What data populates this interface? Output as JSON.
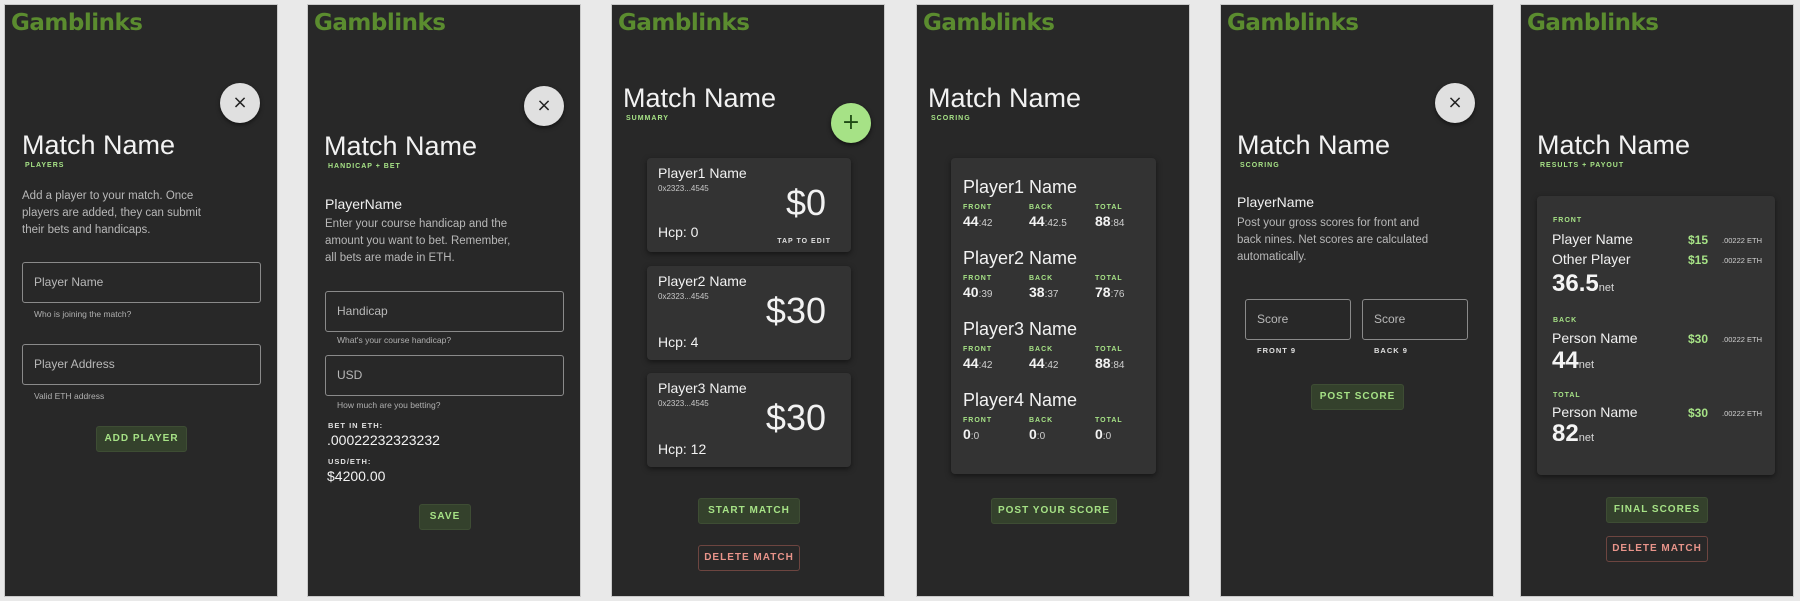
{
  "brand": "Gamblinks",
  "screens": {
    "players": {
      "title": "Match Name",
      "subtitle": "PLAYERS",
      "close": "×",
      "intro": "Add a player to your match. Once players are added, they can submit their bets and handicaps.",
      "name_placeholder": "Player Name",
      "name_hint": "Who is joining the match?",
      "address_placeholder": "Player Address",
      "address_hint": "Valid ETH address",
      "add_button": "ADD PLAYER"
    },
    "handicap": {
      "title": "Match Name",
      "subtitle": "HANDICAP + BET",
      "close": "×",
      "player": "PlayerName",
      "intro": "Enter your course handicap and the amount you want to bet. Remember, all bets are made in ETH.",
      "handicap_placeholder": "Handicap",
      "handicap_hint": "What's your course handicap?",
      "usd_placeholder": "USD",
      "usd_hint": "How much are you betting?",
      "bet_eth_label": "BET IN ETH:",
      "bet_eth_value": ".00022232323232",
      "usd_eth_label": "USD/ETH:",
      "usd_eth_value": "$4200.00",
      "save_button": "SAVE"
    },
    "summary": {
      "title": "Match Name",
      "subtitle": "SUMMARY",
      "add": "+",
      "players": [
        {
          "name": "Player1 Name",
          "address": "0x2323...4545",
          "amount": "$0",
          "hcp": "Hcp: 0",
          "tap": "TAP TO EDIT"
        },
        {
          "name": "Player2 Name",
          "address": "0x2323...4545",
          "amount": "$30",
          "hcp": "Hcp: 4"
        },
        {
          "name": "Player3 Name",
          "address": "0x2323...4545",
          "amount": "$30",
          "hcp": "Hcp: 12"
        }
      ],
      "start_button": "START MATCH",
      "delete_button": "DELETE MATCH"
    },
    "scoring": {
      "title": "Match Name",
      "subtitle": "SCORING",
      "labels": {
        "front": "FRONT",
        "back": "BACK",
        "total": "TOTAL"
      },
      "players": [
        {
          "name": "Player1 Name",
          "front": "44",
          "front_net": ":42",
          "back": "44",
          "back_net": ":42.5",
          "total": "88",
          "total_net": ":84"
        },
        {
          "name": "Player2 Name",
          "front": "40",
          "front_net": ":39",
          "back": "38",
          "back_net": ":37",
          "total": "78",
          "total_net": ":76"
        },
        {
          "name": "Player3 Name",
          "front": "44",
          "front_net": ":42",
          "back": "44",
          "back_net": ":42",
          "total": "88",
          "total_net": ":84"
        },
        {
          "name": "Player4 Name",
          "front": "0",
          "front_net": ":0",
          "back": "0",
          "back_net": ":0",
          "total": "0",
          "total_net": ":0"
        }
      ],
      "post_button": "POST YOUR SCORE"
    },
    "post": {
      "title": "Match Name",
      "subtitle": "SCORING",
      "close": "×",
      "player": "PlayerName",
      "intro": "Post your gross scores for front and back nines. Net scores are calculated automatically.",
      "front_placeholder": "Score",
      "front_label": "FRONT 9",
      "back_placeholder": "Score",
      "back_label": "BACK 9",
      "post_button": "POST SCORE"
    },
    "results": {
      "title": "Match Name",
      "subtitle": "RESULTS + PAYOUT",
      "net_unit": "net",
      "front": {
        "label": "FRONT",
        "rows": [
          {
            "name": "Player Name",
            "amount": "$15",
            "eth": ".00222 ETH"
          },
          {
            "name": "Other Player",
            "amount": "$15",
            "eth": ".00222 ETH"
          }
        ],
        "net": "36.5"
      },
      "back": {
        "label": "BACK",
        "rows": [
          {
            "name": "Person Name",
            "amount": "$30",
            "eth": ".00222 ETH"
          }
        ],
        "net": "44"
      },
      "total": {
        "label": "TOTAL",
        "rows": [
          {
            "name": "Person Name",
            "amount": "$30",
            "eth": ".00222 ETH"
          }
        ],
        "net": "82"
      },
      "final_button": "FINAL SCORES",
      "delete_button": "DELETE MATCH"
    }
  },
  "colors": {
    "background": "#e9e9e9",
    "screen": "#282828",
    "card": "#333333",
    "brand": "#5b8c2f",
    "accent": "#a6e286",
    "danger": "#e8948a"
  }
}
